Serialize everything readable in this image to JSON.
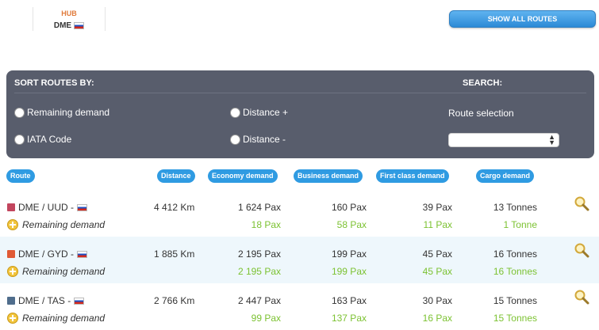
{
  "hub": {
    "label": "HUB",
    "code": "DME",
    "flag_icon": "russia-flag-icon"
  },
  "show_all_routes": "SHOW ALL ROUTES",
  "sort": {
    "title": "SORT ROUTES BY:",
    "options": [
      "Remaining demand",
      "IATA Code",
      "Distance +",
      "Distance -"
    ]
  },
  "search": {
    "title": "SEARCH:",
    "route_selection_label": "Route selection",
    "selected_value": ""
  },
  "columns": [
    "Route",
    "Distance",
    "Economy demand",
    "Business demand",
    "First class demand",
    "Cargo demand"
  ],
  "remaining_label": "Remaining demand",
  "routes": [
    {
      "name": "DME / UUD -",
      "color": "#c2455e",
      "distance": "4 412 Km",
      "economy": "1 624 Pax",
      "business": "160 Pax",
      "first": "39 Pax",
      "cargo": "13 Tonnes",
      "rem_economy": "18 Pax",
      "rem_business": "58 Pax",
      "rem_first": "11 Pax",
      "rem_cargo": "1 Tonne"
    },
    {
      "name": "DME / GYD -",
      "color": "#e05a35",
      "distance": "1 885 Km",
      "economy": "2 195 Pax",
      "business": "199 Pax",
      "first": "45 Pax",
      "cargo": "16 Tonnes",
      "rem_economy": "2 195 Pax",
      "rem_business": "199 Pax",
      "rem_first": "45 Pax",
      "rem_cargo": "16 Tonnes"
    },
    {
      "name": "DME / TAS -",
      "color": "#4f6d8c",
      "distance": "2 766 Km",
      "economy": "2 447 Pax",
      "business": "163 Pax",
      "first": "30 Pax",
      "cargo": "15 Tonnes",
      "rem_economy": "99 Pax",
      "rem_business": "137 Pax",
      "rem_first": "16 Pax",
      "rem_cargo": "15 Tonnes"
    }
  ],
  "colors": {
    "accent": "#2f9be2",
    "panel": "#585d6c",
    "remaining_green": "#7cc232",
    "hub_orange": "#e07a3a"
  }
}
